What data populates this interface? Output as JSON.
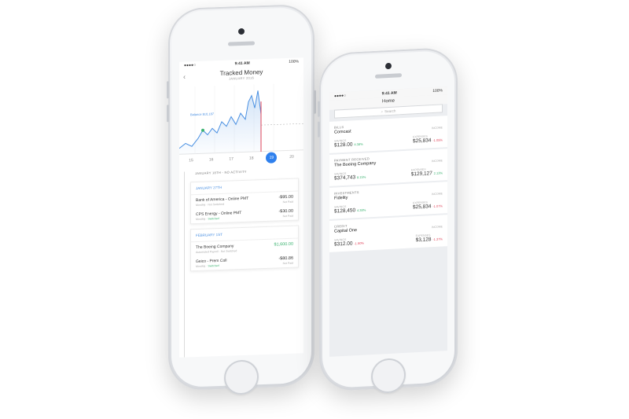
{
  "left_phone": {
    "status": {
      "time": "9:41 AM",
      "battery": "100%"
    },
    "header": {
      "title": "Tracked Money",
      "subtitle": "JANUARY 2016",
      "back_icon": "chevron-left-icon"
    },
    "chart": {
      "label": "Balance $10,187",
      "accent": "#4a90e2",
      "marker": "#e0445a"
    },
    "dates": [
      "15",
      "16",
      "17",
      "18",
      "19",
      "20"
    ],
    "selected_date": "19",
    "activity_header": "JANUARY 18TH - NO ACTIVITY",
    "groups": [
      {
        "day": "JANUARY 27TH",
        "items": [
          {
            "name": "Bank of America - Online PMT",
            "meta": "Monthly",
            "meta2": "Not Switched",
            "amount": "-$95.00",
            "status": "Not Paid"
          },
          {
            "name": "CPS Energy - Online PMT",
            "meta": "Monthly",
            "meta2": "Switched",
            "amount": "-$30.00",
            "status": "Not Paid"
          }
        ]
      },
      {
        "day": "FEBRUARY 1ST",
        "items": [
          {
            "name": "The Boeing Company",
            "meta": "Automated Payroll",
            "meta2": "Not Switched",
            "amount": "$1,600.00",
            "status": ""
          },
          {
            "name": "Geico - Prem Coll",
            "meta": "Monthly",
            "meta2": "Switched",
            "amount": "-$80.86",
            "status": "Not Paid"
          }
        ]
      }
    ]
  },
  "right_phone": {
    "status": {
      "time": "9:41 AM",
      "battery": "100%"
    },
    "nav_title": "Home",
    "search_placeholder": "Search",
    "accounts": [
      {
        "category": "BILLS",
        "name": "Comcast",
        "saving_label": "SAVINGS",
        "saving": "$128.00",
        "saving_change": "4.38%",
        "saving_dir": "up",
        "expense_label": "EXPENSES",
        "expense": "$25,834",
        "expense_change": "-1.05%",
        "expense_dir": "down",
        "tag": "INCOME"
      },
      {
        "category": "PAYMENT RECEIVED",
        "name": "The Boeing Company",
        "saving_label": "SAVINGS",
        "saving": "$374,743",
        "saving_change": "8.15%",
        "saving_dir": "up",
        "expense_label": "EXPENSES",
        "expense": "$129,127",
        "expense_change": "2.13%",
        "expense_dir": "up",
        "tag": "INCOME"
      },
      {
        "category": "INVESTMENTS",
        "name": "Fidelity",
        "saving_label": "SAVINGS",
        "saving": "$128,450",
        "saving_change": "4.38%",
        "saving_dir": "up",
        "expense_label": "EXPENSES",
        "expense": "$25,834",
        "expense_change": "-1.07%",
        "expense_dir": "down",
        "tag": "INCOME"
      },
      {
        "category": "CREDIT",
        "name": "Capital One",
        "saving_label": "SAVINGS",
        "saving": "$312.00",
        "saving_change": "-1.50%",
        "saving_dir": "down",
        "expense_label": "EXPENSES",
        "expense": "$3,128",
        "expense_change": "-1.37%",
        "expense_dir": "down",
        "tag": "INCOME"
      }
    ]
  }
}
